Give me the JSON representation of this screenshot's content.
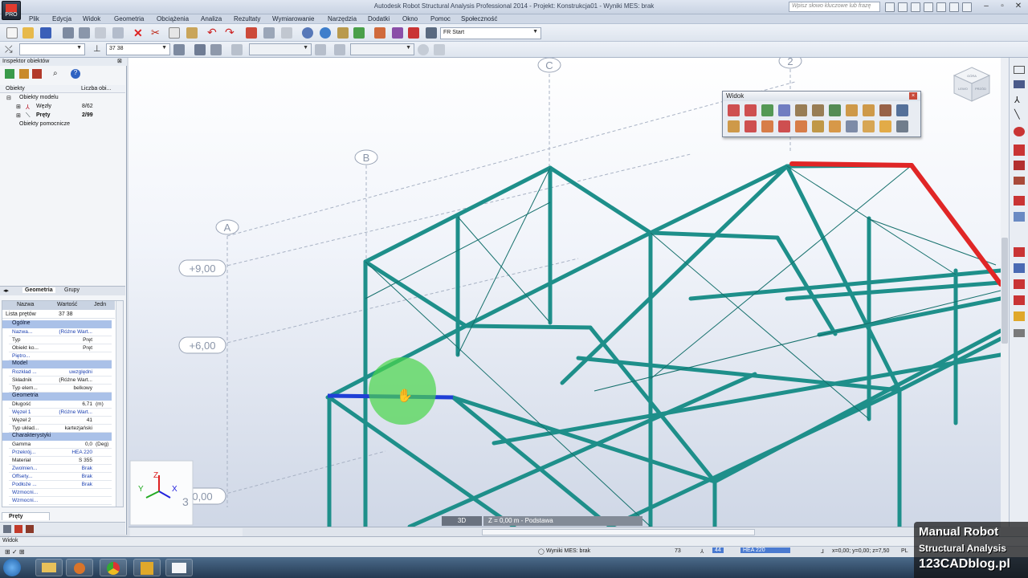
{
  "titlebar": {
    "app_badge": "PRO",
    "title": "Autodesk Robot Structural Analysis Professional 2014 - Projekt: Konstrukcja01 - Wyniki MES: brak",
    "search_placeholder": "Wpisz słowo kluczowe lub frazę"
  },
  "menu": [
    "Plik",
    "Edycja",
    "Widok",
    "Geometria",
    "Obciążenia",
    "Analiza",
    "Rezultaty",
    "Wymiarowanie",
    "Narzędzia",
    "Dodatki",
    "Okno",
    "Pomoc",
    "Społeczność"
  ],
  "toolbar": {
    "layout_combo": "Start",
    "layout_combo_prefix": "FR",
    "step_value": "37 38"
  },
  "inspector": {
    "title": "Inspektor obiektów",
    "col_objects": "Obiekty",
    "col_count": "Liczba obi...",
    "tree": [
      {
        "label": "Obiekty modelu",
        "count": ""
      },
      {
        "label": "Węzły",
        "count": "8/62"
      },
      {
        "label": "Pręty",
        "count": "2/99"
      },
      {
        "label": "Obiekty pomocnicze",
        "count": ""
      }
    ],
    "tabs": [
      "Geometria",
      "Grupy"
    ]
  },
  "props": {
    "col_name": "Nazwa",
    "col_value": "Wartość",
    "col_unit": "Jedn",
    "list_label": "Lista prętów",
    "list_value": "37 38",
    "sections": [
      {
        "title": "Ogólne",
        "rows": [
          [
            "Nazwa...",
            "(Różne Wart...",
            ""
          ],
          [
            "Typ",
            "Pręt",
            ""
          ],
          [
            "Obiekt ko...",
            "Pręt",
            ""
          ],
          [
            "Piętro...",
            "",
            ""
          ]
        ]
      },
      {
        "title": "Model",
        "rows": [
          [
            "Rozkład ...",
            "uwzględni",
            ""
          ],
          [
            "Składnik",
            "(Różne Wart...",
            ""
          ],
          [
            "Typ elem...",
            "belkowy",
            ""
          ]
        ]
      },
      {
        "title": "Geometria",
        "rows": [
          [
            "Długość",
            "6,71",
            "(m)"
          ],
          [
            "Węzeł 1",
            "(Różne Wart...",
            ""
          ],
          [
            "Węzeł 2",
            "41",
            ""
          ],
          [
            "Typ układ...",
            "kartezjański",
            ""
          ]
        ]
      },
      {
        "title": "Charakterystyki",
        "rows": [
          [
            "Gamma",
            "0,0",
            "(Deg)"
          ],
          [
            "Przekrój...",
            "HEA 220",
            ""
          ],
          [
            "Materiał",
            "S 355",
            ""
          ],
          [
            "Zwolnien...",
            "Brak",
            ""
          ],
          [
            "Offsety...",
            "Brak",
            ""
          ],
          [
            "Podłoże ...",
            "Brak",
            ""
          ],
          [
            "Wzmocni...",
            "",
            ""
          ],
          [
            "Wzmocni...",
            "",
            ""
          ]
        ]
      }
    ],
    "bottom_tab": "Pręty"
  },
  "viewport": {
    "grid_labels": [
      "C",
      "2",
      "B",
      "A",
      "3"
    ],
    "levels": [
      "+9,00",
      "+6,00",
      "0,00"
    ],
    "axes": {
      "x": "X",
      "y": "Y",
      "z": "Z"
    },
    "cube_labels": [
      "GÓRA",
      "PRZÓD",
      "LEWO"
    ],
    "colors": {
      "structure": "#1e8f8a",
      "selected_blue": "#1f3fd6",
      "selected_red": "#e02626",
      "highlight": "#49d64a"
    }
  },
  "widok_window": {
    "title": "Widok"
  },
  "bottombar": {
    "view_tab": "3D",
    "level_tab": "Z = 0,00 m - Podstawa"
  },
  "status": {
    "left_label": "Widok",
    "results": "Wyniki MES: brak",
    "num1": "73",
    "num2": "44",
    "section": "HEA 220",
    "coords": "x=0,00; y=0,00; z=7,50",
    "unit": "PL"
  },
  "watermark": {
    "line1": "Manual Robot",
    "line2": "Structural Analysis",
    "line3": "123CADblog.pl"
  }
}
